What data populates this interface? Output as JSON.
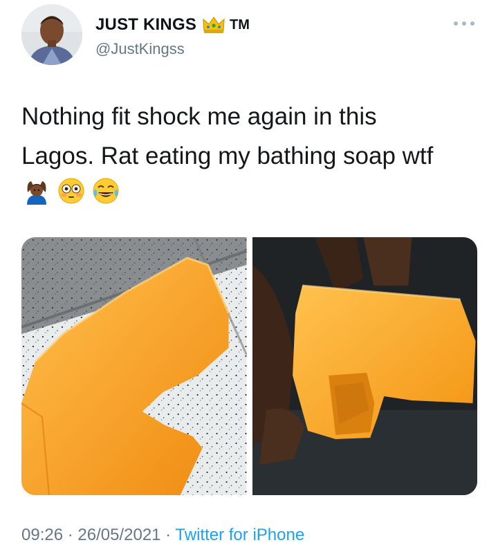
{
  "author": {
    "display_name": "JUST KINGS",
    "badge_icon": "crown-emoji",
    "trademark": "TM",
    "handle": "@JustKingss"
  },
  "tweet": {
    "text_line1": "Nothing fit shock me again in this",
    "text_line2": "Lagos. Rat eating my bathing soap wtf",
    "emojis": [
      "man-gesturing-ok-emoji",
      "flushed-face-emoji",
      "tears-of-joy-emoji"
    ]
  },
  "media": {
    "photos": [
      {
        "description_icon": "photo-soap-on-speckled-surface"
      },
      {
        "description_icon": "photo-soap-held-in-hand"
      }
    ]
  },
  "footer": {
    "time": "09:26",
    "sep1": " · ",
    "date": "26/05/2021",
    "sep2": " · ",
    "source": "Twitter for iPhone"
  },
  "colors": {
    "text": "#0f1419",
    "secondary": "#657786",
    "link": "#1da1f2",
    "soap": "#f5a623"
  }
}
